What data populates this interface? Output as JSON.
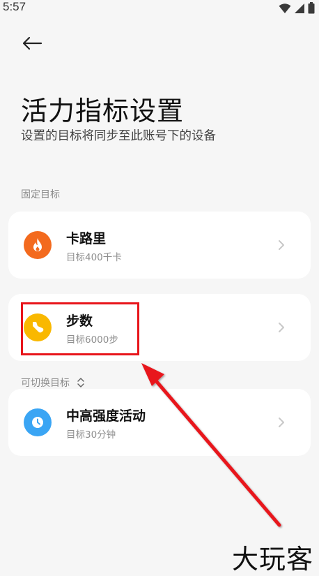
{
  "status_bar": {
    "time": "5:57",
    "icons": [
      "wifi-icon",
      "signal-icon",
      "battery-icon"
    ]
  },
  "header": {
    "back_icon": "arrow-left-icon",
    "title": "活力指标设置",
    "subtitle": "设置的目标将同步至此账号下的设备"
  },
  "sections": {
    "fixed_label": "固定目标",
    "switchable_label": "可切换目标"
  },
  "cards": [
    {
      "title": "卡路里",
      "subtitle": "目标400千卡",
      "icon": "flame-icon",
      "color": "#f36a1e"
    },
    {
      "title": "步数",
      "subtitle": "目标6000步",
      "icon": "shoe-icon",
      "color": "#f9b800"
    },
    {
      "title": "中高强度活动",
      "subtitle": "目标30分钟",
      "icon": "clock-icon",
      "color": "#3aa5f4"
    }
  ],
  "annotation_color": "#e8151b",
  "watermark": "大玩客"
}
